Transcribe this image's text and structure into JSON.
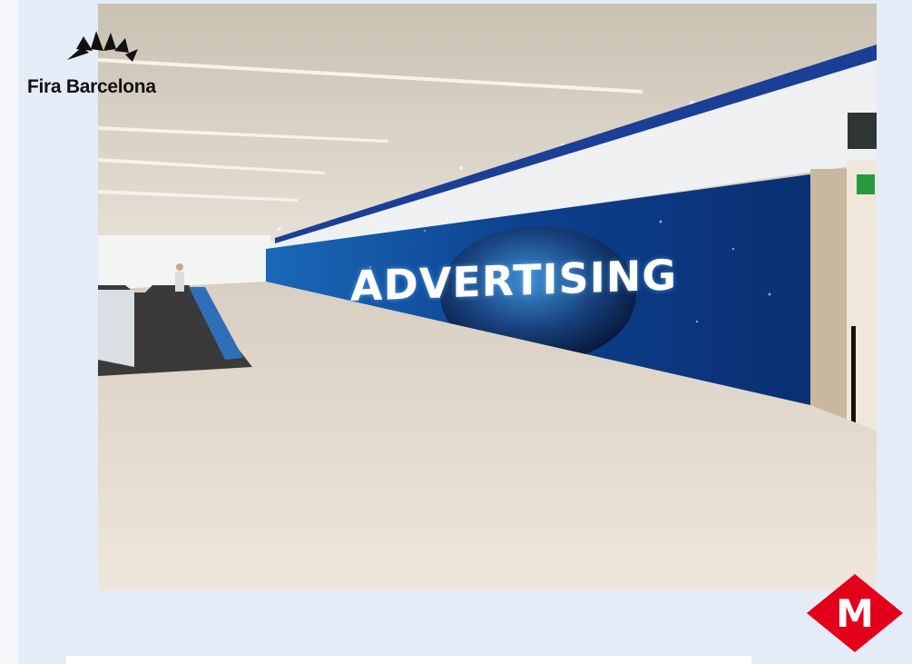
{
  "brand": {
    "name": "Fira Barcelona",
    "mark_icon": "fira-barcelona-logo-icon"
  },
  "photo": {
    "ad_text": "ADVERTISING",
    "description_icon": "tunnel-led-screen-photo"
  },
  "metro": {
    "letter": "M",
    "icon": "metro-logo-icon",
    "color": "#e3001b"
  },
  "colors": {
    "panel_background": "#e4ecf7",
    "screen_blue": "#0c3f8c"
  }
}
